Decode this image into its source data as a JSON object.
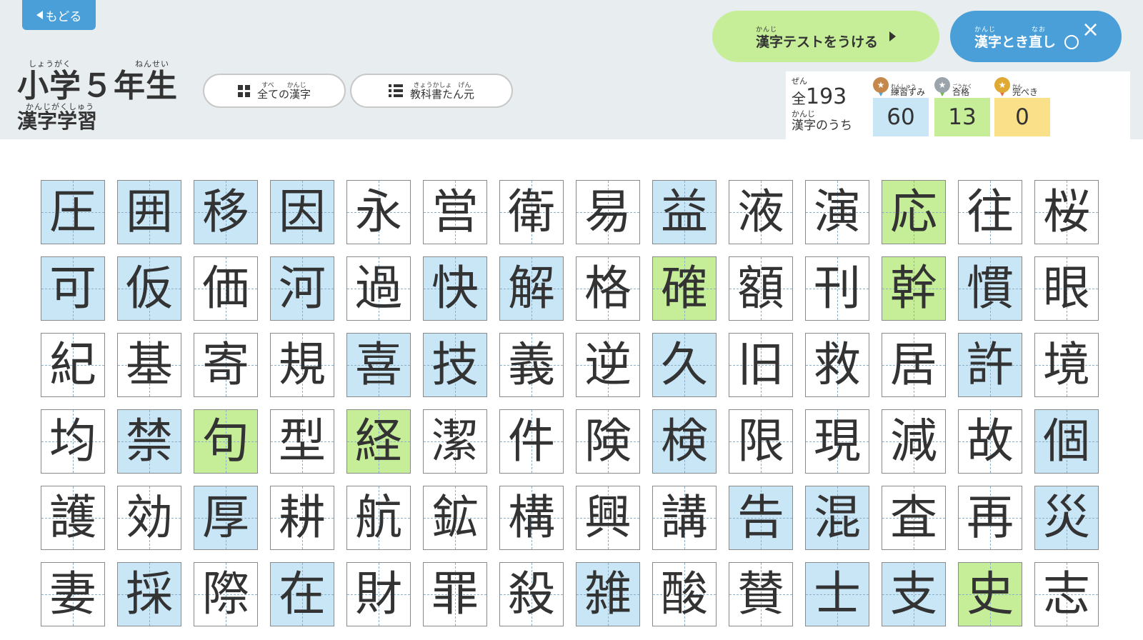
{
  "header": {
    "back_label": "もどる",
    "title_ruby_1": "しょうがく",
    "title_ruby_2": "ねんせい",
    "title": "小学５年生",
    "subtitle_ruby": "かんじがくしゅう",
    "subtitle": "漢字学習"
  },
  "filters": {
    "all_ruby": "すべ　　かんじ",
    "all_label": "全ての漢字",
    "textbook_ruby": "きょうかしょ　げん",
    "textbook_label": "教科書たん元"
  },
  "actions": {
    "test_ruby": "かんじ",
    "test_label": "漢字テストをうける",
    "redo_ruby": "かんじ　　　　　なお",
    "redo_label": "漢字とき直し"
  },
  "stats": {
    "total_ruby": "ぜん",
    "total_prefix": "全",
    "total_count": "193",
    "kanji_ruby": "かんじ",
    "of_label": "漢字のうち",
    "practiced": {
      "ruby": "れんしゅう",
      "label": "練習ずみ",
      "count": "60",
      "color": "#c9e6f7"
    },
    "passed": {
      "ruby": "ごうかく",
      "label": "合格",
      "count": "13",
      "color": "#c6ee98"
    },
    "mastered": {
      "ruby": "かん",
      "label": "完ぺき",
      "count": "0",
      "color": "#fbe08a"
    }
  },
  "colors": {
    "accent_blue": "#4a9fd8",
    "test_green": "#c6ee98",
    "header_bg": "#e8eef0"
  },
  "kanji": [
    {
      "char": "圧",
      "status": "practiced"
    },
    {
      "char": "囲",
      "status": "practiced"
    },
    {
      "char": "移",
      "status": "practiced"
    },
    {
      "char": "因",
      "status": "practiced"
    },
    {
      "char": "永",
      "status": "none"
    },
    {
      "char": "営",
      "status": "none"
    },
    {
      "char": "衛",
      "status": "none"
    },
    {
      "char": "易",
      "status": "none"
    },
    {
      "char": "益",
      "status": "practiced"
    },
    {
      "char": "液",
      "status": "none"
    },
    {
      "char": "演",
      "status": "none"
    },
    {
      "char": "応",
      "status": "passed"
    },
    {
      "char": "往",
      "status": "none"
    },
    {
      "char": "桜",
      "status": "none"
    },
    {
      "char": "可",
      "status": "practiced"
    },
    {
      "char": "仮",
      "status": "practiced"
    },
    {
      "char": "価",
      "status": "none"
    },
    {
      "char": "河",
      "status": "practiced"
    },
    {
      "char": "過",
      "status": "none"
    },
    {
      "char": "快",
      "status": "practiced"
    },
    {
      "char": "解",
      "status": "practiced"
    },
    {
      "char": "格",
      "status": "none"
    },
    {
      "char": "確",
      "status": "passed"
    },
    {
      "char": "額",
      "status": "none"
    },
    {
      "char": "刊",
      "status": "none"
    },
    {
      "char": "幹",
      "status": "passed"
    },
    {
      "char": "慣",
      "status": "practiced"
    },
    {
      "char": "眼",
      "status": "none"
    },
    {
      "char": "紀",
      "status": "none"
    },
    {
      "char": "基",
      "status": "none"
    },
    {
      "char": "寄",
      "status": "none"
    },
    {
      "char": "規",
      "status": "none"
    },
    {
      "char": "喜",
      "status": "practiced"
    },
    {
      "char": "技",
      "status": "practiced"
    },
    {
      "char": "義",
      "status": "none"
    },
    {
      "char": "逆",
      "status": "none"
    },
    {
      "char": "久",
      "status": "practiced"
    },
    {
      "char": "旧",
      "status": "none"
    },
    {
      "char": "救",
      "status": "none"
    },
    {
      "char": "居",
      "status": "none"
    },
    {
      "char": "許",
      "status": "practiced"
    },
    {
      "char": "境",
      "status": "none"
    },
    {
      "char": "均",
      "status": "none"
    },
    {
      "char": "禁",
      "status": "practiced"
    },
    {
      "char": "句",
      "status": "passed"
    },
    {
      "char": "型",
      "status": "none"
    },
    {
      "char": "経",
      "status": "passed"
    },
    {
      "char": "潔",
      "status": "none"
    },
    {
      "char": "件",
      "status": "none"
    },
    {
      "char": "険",
      "status": "none"
    },
    {
      "char": "検",
      "status": "practiced"
    },
    {
      "char": "限",
      "status": "none"
    },
    {
      "char": "現",
      "status": "none"
    },
    {
      "char": "減",
      "status": "none"
    },
    {
      "char": "故",
      "status": "none"
    },
    {
      "char": "個",
      "status": "practiced"
    },
    {
      "char": "護",
      "status": "none"
    },
    {
      "char": "効",
      "status": "none"
    },
    {
      "char": "厚",
      "status": "practiced"
    },
    {
      "char": "耕",
      "status": "none"
    },
    {
      "char": "航",
      "status": "none"
    },
    {
      "char": "鉱",
      "status": "none"
    },
    {
      "char": "構",
      "status": "none"
    },
    {
      "char": "興",
      "status": "none"
    },
    {
      "char": "講",
      "status": "none"
    },
    {
      "char": "告",
      "status": "practiced"
    },
    {
      "char": "混",
      "status": "practiced"
    },
    {
      "char": "査",
      "status": "none"
    },
    {
      "char": "再",
      "status": "none"
    },
    {
      "char": "災",
      "status": "practiced"
    },
    {
      "char": "妻",
      "status": "none"
    },
    {
      "char": "採",
      "status": "practiced"
    },
    {
      "char": "際",
      "status": "none"
    },
    {
      "char": "在",
      "status": "practiced"
    },
    {
      "char": "財",
      "status": "none"
    },
    {
      "char": "罪",
      "status": "none"
    },
    {
      "char": "殺",
      "status": "none"
    },
    {
      "char": "雑",
      "status": "practiced"
    },
    {
      "char": "酸",
      "status": "none"
    },
    {
      "char": "賛",
      "status": "none"
    },
    {
      "char": "士",
      "status": "practiced"
    },
    {
      "char": "支",
      "status": "practiced"
    },
    {
      "char": "史",
      "status": "passed"
    },
    {
      "char": "志",
      "status": "none"
    }
  ]
}
